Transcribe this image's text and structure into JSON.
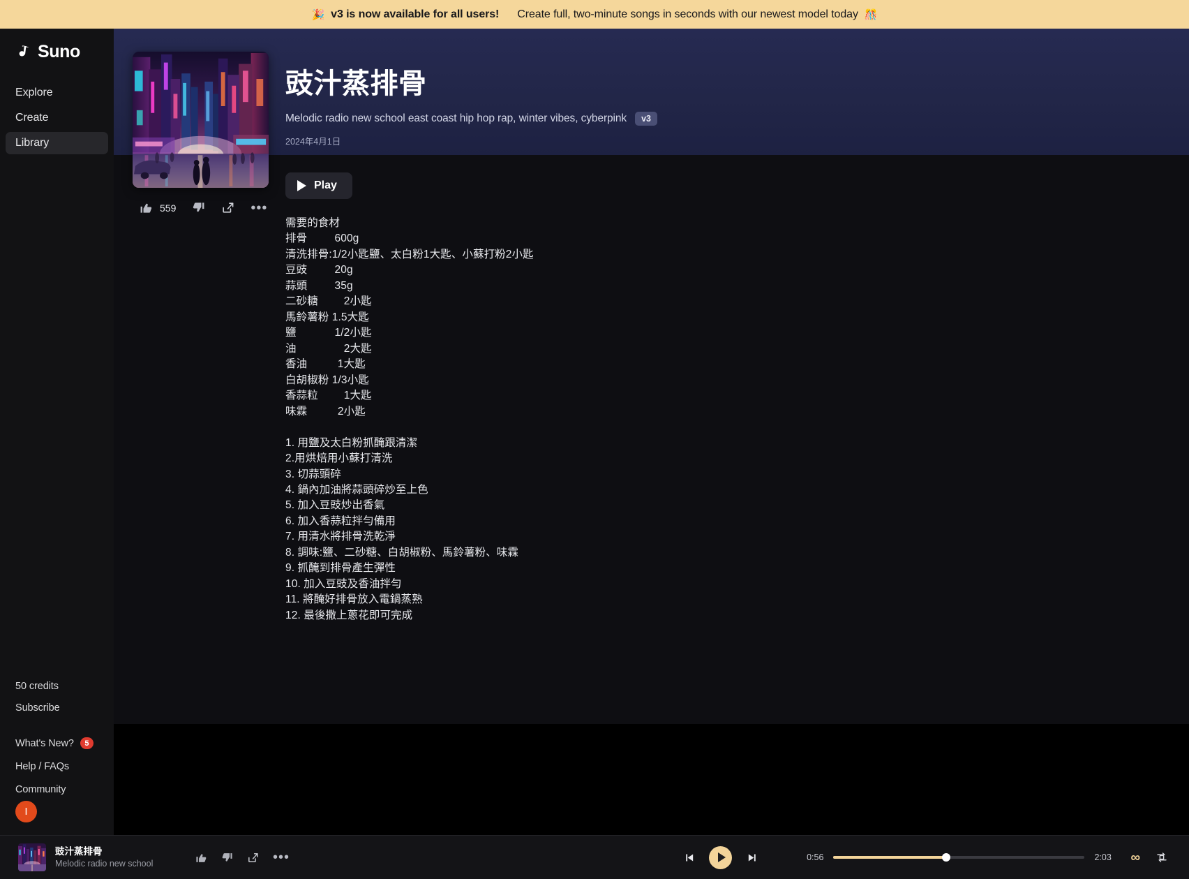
{
  "promo": {
    "icon_left": "party-popper-icon",
    "headline": "v3 is now available for all users!",
    "subtext": "Create full, two-minute songs in seconds with our newest model today",
    "icon_right": "party-popper-icon",
    "emoji_left": "🎉",
    "emoji_right": "🎊",
    "background": "#f5d79b"
  },
  "sidebar": {
    "logo_text": "Suno",
    "items": [
      {
        "label": "Explore",
        "active": false
      },
      {
        "label": "Create",
        "active": false
      },
      {
        "label": "Library",
        "active": true
      }
    ],
    "credits": "50 credits",
    "subscribe": "Subscribe",
    "whats_new": "What's New?",
    "whats_new_badge": "5",
    "help": "Help / FAQs",
    "community": "Community",
    "avatar_initial": "I",
    "avatar_color": "#e24a1b"
  },
  "song": {
    "title": "豉汁蒸排骨",
    "style_tags": "Melodic radio new school east coast hip hop rap, winter vibes, cyberpink",
    "version": "v3",
    "date": "2024年4月1日",
    "play_label": "Play",
    "like_count": "559",
    "cover_alt": "cyberpunk neon city street"
  },
  "lyrics": "需要的食材\n排骨\t\t600g\n清洗排骨:1/2小匙鹽、太白粉1大匙、小蘇打粉2小匙\n豆豉\t\t20g\n蒜頭\t\t35g\n二砂糖\t   2小匙\n馬鈴薯粉 1.5大匙\n鹽\t\t1/2小匙\n油\t\t   2大匙\n香油\t\t 1大匙\n白胡椒粉 1/3小匙\n香蒜粒\t   1大匙\n味霖\t\t 2小匙\n\n1. 用鹽及太白粉抓醃跟清潔\n2.用烘焙用小蘇打清洗\n3. 切蒜頭碎\n4. 鍋內加油將蒜頭碎炒至上色\n5. 加入豆豉炒出香氣\n6. 加入香蒜粒拌勻備用\n7. 用清水將排骨洗乾淨\n8. 調味:鹽、二砂糖、白胡椒粉、馬鈴薯粉、味霖\n9. 抓醃到排骨產生彈性\n10. 加入豆豉及香油拌勻\n11. 將醃好排骨放入電鍋蒸熟\n12. 最後撒上蔥花即可完成",
  "player": {
    "now_playing_title": "豉汁蒸排骨",
    "now_playing_subtitle": "Melodic radio new school",
    "current_time": "0:56",
    "total_time": "2:03",
    "progress_percent": 45,
    "accent_color": "#f3d49a",
    "is_playing": true
  }
}
